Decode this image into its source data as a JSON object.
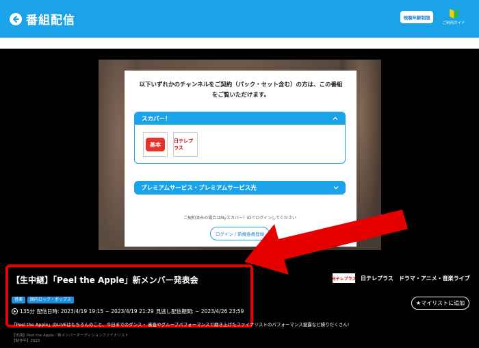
{
  "header": {
    "title": "番組配信",
    "age_button": "視聴年齢制限",
    "guide_label": "ご利用ガイド"
  },
  "modal": {
    "message": "以下いずれかのチャンネルをご契約（パック・セット含む）の方は、この番組をご覧いただけます。",
    "section1": {
      "label": "スカパー！",
      "channels": [
        {
          "logo_text": "基本",
          "icon": "kihon-pack-logo"
        },
        {
          "logo_text": "日テレプラス",
          "icon": "nittele-plus-logo"
        }
      ]
    },
    "section2": {
      "label": "プレミアムサービス・プレミアムサービス光"
    },
    "login_note": "ご契約済みの場合はMyスカパー！IDでログインしてください",
    "login_button": "ログイン / 新規会員登録"
  },
  "program": {
    "title": "【生中継】「Peel the Apple」新メンバー発表会",
    "tags": [
      "音楽",
      "国内ロック・ポップス"
    ],
    "duration": "135分",
    "broadcast": "配信日時: 2023/4/19 19:15 ~ 2023/4/19 21:29",
    "catchup": "見逃し配信期間: ~ 2023/4/26 23:59",
    "channel_logo": "日テレプラス",
    "channel_name": "日テレプラス",
    "channel_genre": "ドラマ・アニメ・音楽ライブ",
    "mylist_button": "★マイリストに追加",
    "description": "「Peel the Apple」のLIVEはもちろんのこと、今日までのダンス・ 審査やグループパフォーマンスで磨き上げたファイナリストのパフォーマンス披露など繰りだくさん!",
    "credit1": "【出演】Peel the Apple／新メンバーオーディションファイナリスト",
    "credit2": "【制作年】2023"
  },
  "colors": {
    "accent": "#1aa3e8",
    "highlight": "#e60000"
  }
}
